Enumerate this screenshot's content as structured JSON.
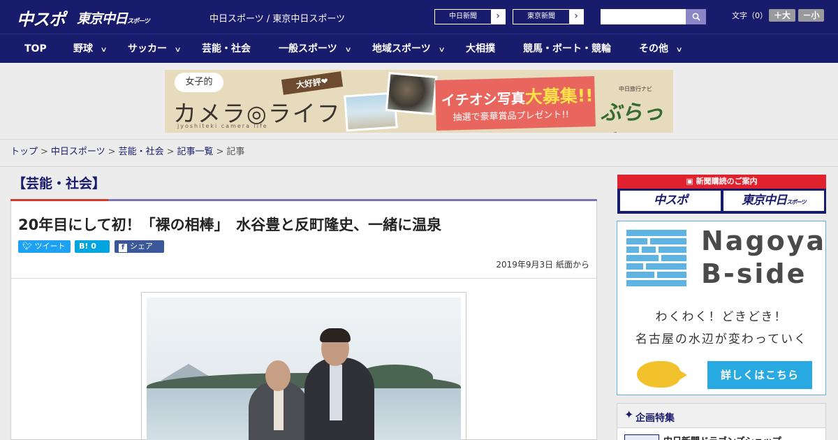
{
  "header": {
    "logo_chuspo": "中スポ",
    "logo_tokyo": "東京中日",
    "logo_tokyo_small": "スポーツ",
    "site_links": "中日スポーツ / 東京中日スポーツ",
    "paper_chunichi": "中日新聞",
    "paper_tokyo": "東京新聞",
    "search_placeholder": "",
    "font_label": "文字（0）",
    "font_big": "＋大",
    "font_small": "－小"
  },
  "nav": [
    {
      "label": "TOP",
      "dropdown": false
    },
    {
      "label": "野球",
      "dropdown": true
    },
    {
      "label": "サッカー",
      "dropdown": true
    },
    {
      "label": "芸能・社会",
      "dropdown": false
    },
    {
      "label": "一般スポーツ",
      "dropdown": true
    },
    {
      "label": "地域スポーツ",
      "dropdown": true
    },
    {
      "label": "大相撲",
      "dropdown": false
    },
    {
      "label": "競馬・ボート・競輪",
      "dropdown": false
    },
    {
      "label": "その他",
      "dropdown": true
    }
  ],
  "banner": {
    "bubble": "女子的",
    "title": "カメラ◎ライフ",
    "sub": "jyoshiteki camera life",
    "award": "大好評❤",
    "line1_pre": "イチオシ写真",
    "line1_em": "大募集!!",
    "line2": "抽選で豪華賞品プレゼント!!",
    "brand_label": "中日旅行ナビ",
    "brand": "ぶらっ人"
  },
  "breadcrumb": {
    "items": [
      "トップ",
      "中日スポーツ",
      "芸能・社会",
      "記事一覧"
    ],
    "current": "記事"
  },
  "category": "【芸能・社会】",
  "article": {
    "title": "20年目にして初！「裸の相棒」　水谷豊と反町隆史、一緒に温泉",
    "share_tweet": "ツイート",
    "share_hatena": "B!  0",
    "share_fb_icon": "f",
    "share_fb": "シェア 0",
    "date": "2019年9月3日 紙面から"
  },
  "sidebar": {
    "subscribe_label": "新聞購読のご案内",
    "subscribe_chuspo": "中スポ",
    "subscribe_tokyo": "東京中日",
    "subscribe_tokyo_small": "スポーツ",
    "bside_title1": "Nagoya",
    "bside_title2": "B-side",
    "bside_catch1": "わくわく！どきどき！",
    "bside_catch2": "名古屋の水辺が変わっていく",
    "bside_button": "詳しくはこちら",
    "feature_head": "企画特集",
    "feature_item": "中日新聞ドラゴンズショップ"
  },
  "colors": {
    "brand_navy": "#191b6c",
    "accent_red": "#e0222e",
    "bside_blue": "#29a9e2"
  }
}
